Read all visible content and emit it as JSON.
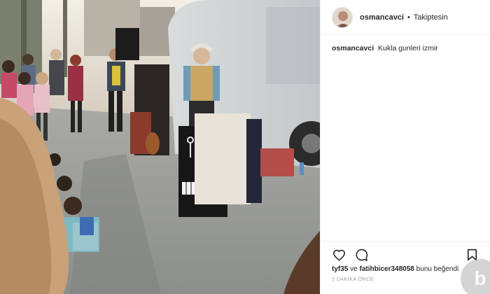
{
  "post": {
    "username": "osmancavci",
    "separator": "•",
    "follow_status": "Takiptesin",
    "caption": "Kukla gunleri izmir",
    "likes": {
      "user1": "tyf35",
      "conjunction": "ve",
      "user2": "fatihbicer348058",
      "suffix": "bunu beğendi"
    },
    "timestamp": "2 DAKİKA ÖNCE",
    "icons": [
      "heart-icon",
      "comment-icon",
      "bookmark-icon"
    ]
  },
  "colors": {
    "text": "#262626",
    "muted": "#999999",
    "border": "#efefef"
  }
}
